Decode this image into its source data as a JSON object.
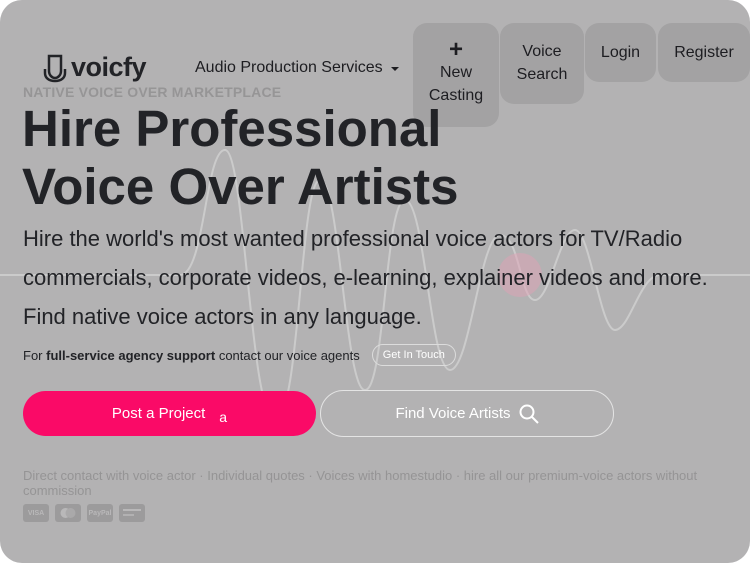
{
  "header": {
    "logo_text": "voicfy",
    "nav_dropdown_label": "Audio Production Services",
    "new_casting": {
      "plus": "+",
      "line1": "New",
      "line2": "Casting"
    },
    "voice_search": {
      "line1": "Voice",
      "line2": "Search"
    },
    "login_label": "Login",
    "register_label": "Register"
  },
  "hero": {
    "eyebrow": "NATIVE VOICE OVER MARKETPLACE",
    "headline_line1": "Hire Professional",
    "headline_line2": "Voice Over Artists",
    "intro": "Hire the world's most wanted professional voice actors for TV/Radio commercials, corporate videos, e-learning, explainer videos and more. Find native voice actors in any language.",
    "agency_prefix": "For",
    "agency_bold": "full-service agency support",
    "agency_suffix": "contact our voice agents",
    "get_in_touch": "Get In Touch",
    "post_project": "Post a Project",
    "post_trailing": "a",
    "find_artists": "Find Voice Artists",
    "fineprint": "Direct contact with voice actor · Individual quotes · Voices with homestudio · hire all our premium-voice actors without commission"
  },
  "payments": [
    {
      "label": "VISA",
      "icon": "visa-icon"
    },
    {
      "label": "",
      "icon": "mastercard-icon"
    },
    {
      "label": "PayPal",
      "icon": "paypal-icon"
    },
    {
      "label": "",
      "icon": "bank-card-icon"
    }
  ],
  "colors": {
    "overlay": "#b3b2b3",
    "primary": "#fa0a67",
    "text": "#222327",
    "nav_button": "#a3a2a3"
  }
}
